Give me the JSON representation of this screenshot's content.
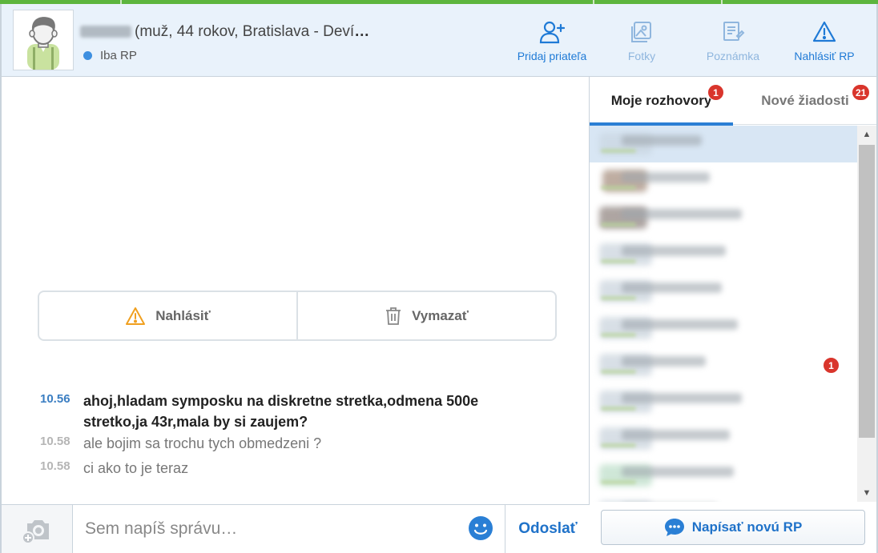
{
  "header": {
    "profile": {
      "name_suffix": "(muž, 44 rokov, Bratislava - Deví",
      "name_truncated": "…",
      "status": "Iba RP",
      "status_color": "#3d8fe0"
    },
    "buttons": [
      {
        "label": "Pridaj priateľa",
        "icon": "add-user-icon"
      },
      {
        "label": "Fotky",
        "icon": "photos-icon"
      },
      {
        "label": "Poznámka",
        "icon": "note-icon"
      },
      {
        "label": "Nahlásiť RP",
        "icon": "warning-icon"
      }
    ]
  },
  "chat": {
    "actions": {
      "report": "Nahlásiť",
      "delete": "Vymazať"
    },
    "messages": [
      {
        "time": "10.56",
        "text": "ahoj,hladam symposku na diskretne stretka,odmena 500e stretko,ja 43r,mala by si zaujem?",
        "bold": true
      },
      {
        "time": "10.58",
        "text": "ale bojim sa trochu tych obmedzeni ?",
        "bold": false
      },
      {
        "time": "10.58",
        "text": "ci ako to je teraz",
        "bold": false
      }
    ]
  },
  "composer": {
    "placeholder": "Sem napíš správu…",
    "send_label": "Odoslať"
  },
  "sidebar": {
    "tabs": [
      {
        "label": "Moje rozhovory",
        "badge": "1"
      },
      {
        "label": "Nové žiadosti",
        "badge": "21"
      }
    ],
    "conversation_unread_badge": "1",
    "new_rp_label": "Napísať novú RP",
    "accent": "#1f72c9"
  }
}
